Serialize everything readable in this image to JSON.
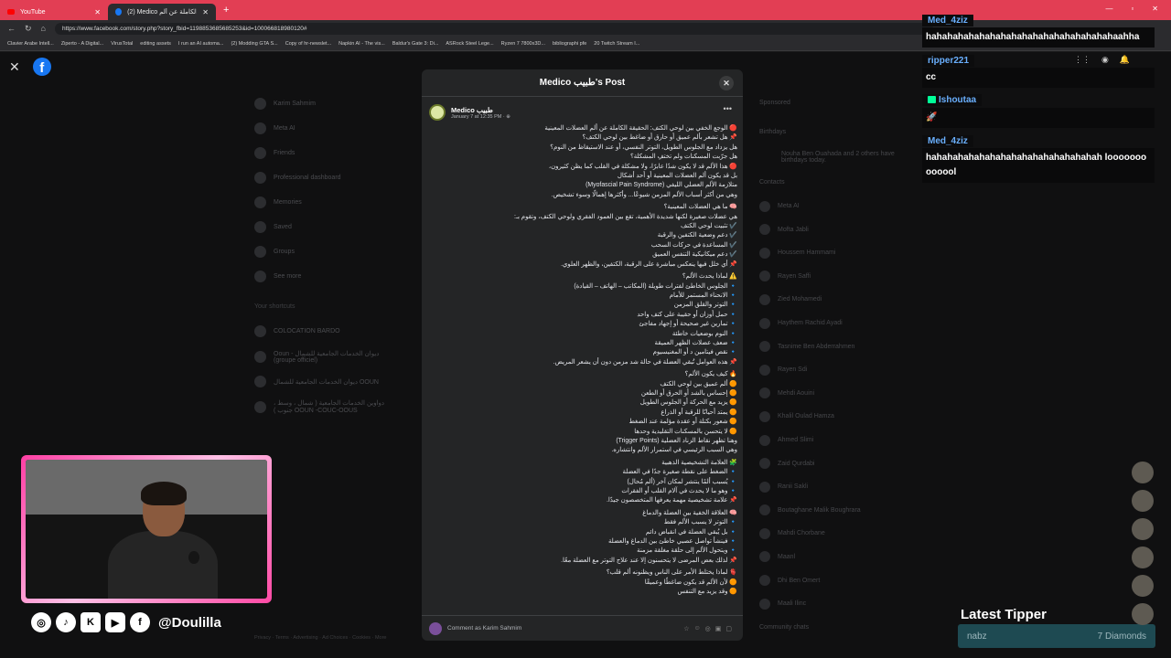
{
  "browser": {
    "tabs": [
      {
        "label": "YouTube"
      },
      {
        "label": "(2) Medico في الحقيقة الكاملة عن ألم"
      }
    ],
    "new_tab": "+",
    "url": "https://www.facebook.com/story.php?story_fbid=1198853685685253&id=100066818980120#",
    "bookmarks": [
      "Clavier Arabe Intell...",
      "Ziperto - A Digital...",
      "VirusTotal",
      "editing assets",
      "I run an AI automa...",
      "(2) Modding GTA S...",
      "Copy of hr-newslet...",
      "Napkin AI - The vis...",
      "Baldur's Gate 3: Di...",
      "ASRock Steel Lege...",
      "Ryzen 7 7800x3D...",
      "bibliographi pfe",
      "20 Twitch Stream I..."
    ]
  },
  "facebook": {
    "left_nav": [
      "Karim Sahmim",
      "Meta AI",
      "Friends",
      "Professional dashboard",
      "Memories",
      "Saved",
      "Groups",
      "See more"
    ],
    "shortcuts_title": "Your shortcuts",
    "shortcuts": [
      "COLOCATION BARDO",
      "Ooun - ديوان الخدمات الجامعية للشمال (groupe officiel)",
      "ديوان الخدمات الجامعية للشمال OOUN",
      "دواوين الخدمات الجامعية ( شمال ، وسط ، جنوب ) OOUN -COUC-OOUS"
    ],
    "right_nav": {
      "sponsored": "Sponsored",
      "birthdays": "Birthdays",
      "birthday_text": "Nouha Ben Ouahada and 2 others have birthdays today.",
      "contacts": "Contacts",
      "contacts_list": [
        "Meta AI",
        "Mofta Jabli",
        "Houssem Hammami",
        "Rayen Saffi",
        "Zied Mohamedi",
        "Haythem Rachid Ayadi",
        "Tasnime Ben Abderrahmen",
        "Rayen Sdi",
        "Mehdi Aouini",
        "Khalil Oulad Hamza",
        "Ahmed Slimi",
        "Zaid Qurdabi",
        "Ranii Sakli",
        "Boutaghane Malik Boughrara",
        "Mahdi Chorbane",
        "Maanl",
        "Dhi Ben Omert",
        "Maali Ilinc"
      ],
      "community": "Community chats"
    },
    "footer": "Privacy · Terms · Advertising · Ad Choices · Cookies · More"
  },
  "post": {
    "modal_title": "Medico طبيب's Post",
    "author": "Medico طبيب",
    "date": "January 7 at 12:35 PM · ⊕",
    "lines": [
      "🔴 الوجع الخفي بين لوحي الكتف: الحقيقة الكاملة عن ألم العضلات المعينية",
      "📌 هل تشعر بألم عميق أو حارق أو ضاغط بين لوحي الكتف؟",
      "هل يزداد مع الجلوس الطويل، التوتر النفسي، أو عند الاستيقاظ من النوم؟",
      "هل جرّبت المسكنات ولم تختفِ المشكلة؟",
      "🔴 هذا الألم قد لا يكون شدًا عابرًا، ولا مشكلة في القلب كما يظن كثيرون،",
      "بل قد يكون ألم العضلات المعينية أو أحد أشكال",
      "متلازمة الألم العضلي الليفي (Myofascial Pain Syndrome)",
      "وهي من أكثر أسباب الألم المزمن شيوعًا... وأكثرها إهمالًا وسوء تشخيص.",
      "",
      "🧠 ما هي العضلات المعينية؟",
      "هي عضلات صغيرة لكنها شديدة الأهمية، تقع بين العمود الفقري ولوحي الكتف، وتقوم بـ:",
      "✔️ تثبيت لوحي الكتف",
      "✔️ دعم وضعية الكتفين والرقبة",
      "✔️ المساعدة في حركات السحب",
      "✔️ دعم ميكانيكية التنفس العميق",
      "📌 أي خلل فيها ينعكس مباشرة على الرقبة، الكتفين، والظهر العلوي.",
      "",
      "⚠️ لماذا يحدث الألم؟",
      "🔹 الجلوس الخاطئ لفترات طويلة (المكاتب – الهاتف – القيادة)",
      "🔹 الانحناء المستمر للأمام",
      "🔹 التوتر والقلق المزمن",
      "🔹 حمل أوزان أو حقيبة على كتف واحد",
      "🔹 تمارين غير صحيحة أو إجهاد مفاجئ",
      "🔹 النوم بوضعيات خاطئة",
      "🔹 ضعف عضلات الظهر العميقة",
      "🔹 نقص فيتامين د أو المغنيسيوم",
      "📌 هذه العوامل تُبقي العضلة في حالة شد مزمن دون أن يشعر المريض.",
      "",
      "🔥 كيف يكون الألم؟",
      "🟠 ألم عميق بين لوحي الكتف",
      "🟠 إحساس بالشد أو الحرق أو الطعن",
      "🟠 يزيد مع الحركة أو الجلوس الطويل",
      "🟠 يمتد أحيانًا للرقبة أو الذراع",
      "🟠 شعور بكتلة أو عقدة مؤلمة عند الضغط",
      "🟠 لا يتحسن بالمسكنات التقليدية وحدها",
      "وهنا تظهر نقاط الزناد العضلية (Trigger Points)",
      "وهي السبب الرئيسي في استمرار الألم وانتشاره.",
      "",
      "🧩 العلامة التشخيصية الذهبية",
      "🔹 الضغط على نقطة صغيرة جدًا في العضلة",
      "🔹 يُسبب ألمًا ينتشر لمكان آخر (ألم مُحال)",
      "🔹 وهو ما لا يحدث في آلام القلب أو الفقرات",
      "📌 علامة تشخيصية مهمة يعرفها المتخصصون جيدًا.",
      "",
      "🧠 العلاقة الخفية بين العضلة والدماغ",
      "🔹 التوتر لا يسبب الألم فقط",
      "🔹 بل يُبقي العضلة في انقباض دائم",
      "🔹 فينشأ تواصل عصبي خاطئ بين الدماغ والعضلة",
      "🔹 ويتحول الألم إلى حلقة مغلقة مزمنة",
      "📌 لذلك بعض المرضى لا يتحسنون إلا عند علاج التوتر مع العضلة معًا.",
      "",
      "🫀 لماذا يختلط الأمر على الناس ويظنونه ألم قلب؟",
      "🟠 لأن الألم قد يكون ضاغطًا وعميقًا",
      "🟠 وقد يزيد مع التنفس"
    ],
    "comment_placeholder": "Comment as Karim Sahmim"
  },
  "stream": {
    "chat": [
      {
        "user": "Med_4ziz",
        "text": "hahahahahahahahahahahahahahahahahahaahha"
      },
      {
        "user": "ripper221",
        "text": "cc"
      },
      {
        "user": "Ishoutaa",
        "text": "🚀"
      },
      {
        "user": "Med_4ziz",
        "text": "hahahahahahahahahahahahahahahahah looooooooooool"
      }
    ],
    "social_handle": "@Doulilla",
    "latest_tipper_title": "Latest Tipper",
    "tipper_name": "nabz",
    "tipper_amount": "7 Diamonds"
  }
}
